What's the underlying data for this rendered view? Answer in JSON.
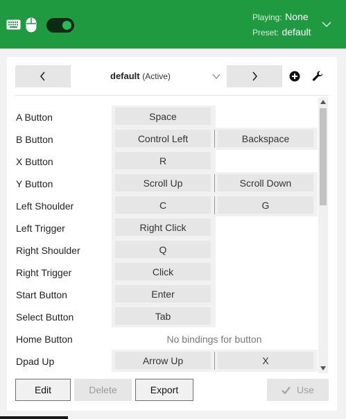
{
  "header": {
    "playing_label": "Playing:",
    "playing_value": "None",
    "preset_label": "Preset:",
    "preset_value": "default",
    "toggle_on": true,
    "accent_color": "#1f9a40"
  },
  "preset_bar": {
    "name": "default",
    "status": "(Active)",
    "icons": [
      "chevron-left-icon",
      "chevron-down-icon",
      "chevron-right-icon",
      "add-circle-icon",
      "wrench-icon"
    ]
  },
  "bindings": [
    {
      "label": "A Button",
      "keys": [
        "Space"
      ]
    },
    {
      "label": "B Button",
      "keys": [
        "Control Left",
        "Backspace"
      ]
    },
    {
      "label": "X Button",
      "keys": [
        "R"
      ]
    },
    {
      "label": "Y Button",
      "keys": [
        "Scroll Up",
        "Scroll Down"
      ]
    },
    {
      "label": "Left Shoulder",
      "keys": [
        "C",
        "G"
      ]
    },
    {
      "label": "Left Trigger",
      "keys": [
        "Right Click"
      ]
    },
    {
      "label": "Right Shoulder",
      "keys": [
        "Q"
      ]
    },
    {
      "label": "Right Trigger",
      "keys": [
        "Click"
      ]
    },
    {
      "label": "Start Button",
      "keys": [
        "Enter"
      ]
    },
    {
      "label": "Select Button",
      "keys": [
        "Tab"
      ]
    },
    {
      "label": "Home Button",
      "keys": [],
      "empty_text": "No bindings for button"
    },
    {
      "label": "Dpad Up",
      "keys": [
        "Arrow Up",
        "X"
      ]
    }
  ],
  "footer": {
    "edit_label": "Edit",
    "delete_label": "Delete",
    "export_label": "Export",
    "use_label": "Use"
  }
}
